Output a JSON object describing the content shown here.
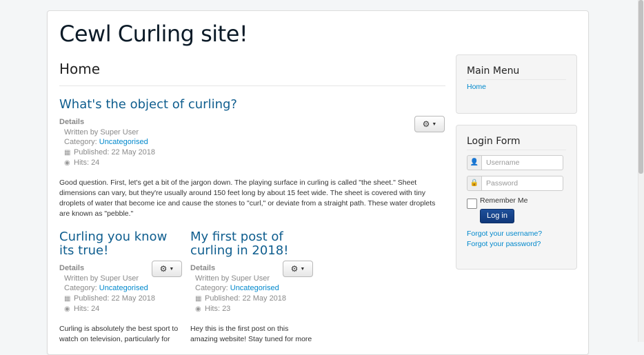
{
  "site": {
    "title": "Cewl Curling site!"
  },
  "page": {
    "heading": "Home"
  },
  "details_labels": {
    "title": "Details",
    "written_by": "Written by Super User",
    "category_prefix": "Category: ",
    "published_prefix": "Published: ",
    "hits_prefix": "Hits: "
  },
  "articles": [
    {
      "title": "What's the object of curling?",
      "category": "Uncategorised",
      "published": "22 May 2018",
      "hits": "24",
      "intro": "Good question. First, let's get a bit of the jargon down. The playing surface in curling is called \"the sheet.\" Sheet dimensions can vary, but they're usually around 150 feet long by about 15 feet wide. The sheet is covered with tiny droplets of water that become ice and cause the stones to \"curl,\" or deviate from a straight path. These water droplets are known as \"pebble.\""
    },
    {
      "title": "Curling you know its true!",
      "category": "Uncategorised",
      "published": "22 May 2018",
      "hits": "24",
      "intro": "Curling is absolutely the best sport to watch on television, particularly for"
    },
    {
      "title": "My first post of curling in 2018!",
      "category": "Uncategorised",
      "published": "22 May 2018",
      "hits": "23",
      "intro": "Hey this is the first post on this amazing website! Stay tuned for more"
    }
  ],
  "sidebar": {
    "main_menu": {
      "title": "Main Menu",
      "items": [
        {
          "label": "Home"
        }
      ]
    },
    "login": {
      "title": "Login Form",
      "username_placeholder": "Username",
      "password_placeholder": "Password",
      "remember_label": "Remember Me",
      "login_label": "Log in",
      "forgot_username": "Forgot your username?",
      "forgot_password": "Forgot your password?"
    }
  },
  "icons": {
    "gear": "gear-icon",
    "caret": "caret-down-icon",
    "calendar": "calendar-icon",
    "eye": "eye-icon",
    "user": "user-icon",
    "lock": "lock-icon"
  },
  "colors": {
    "link": "#0088cc",
    "title_link": "#0e5d8e",
    "login_button": "#174690"
  }
}
